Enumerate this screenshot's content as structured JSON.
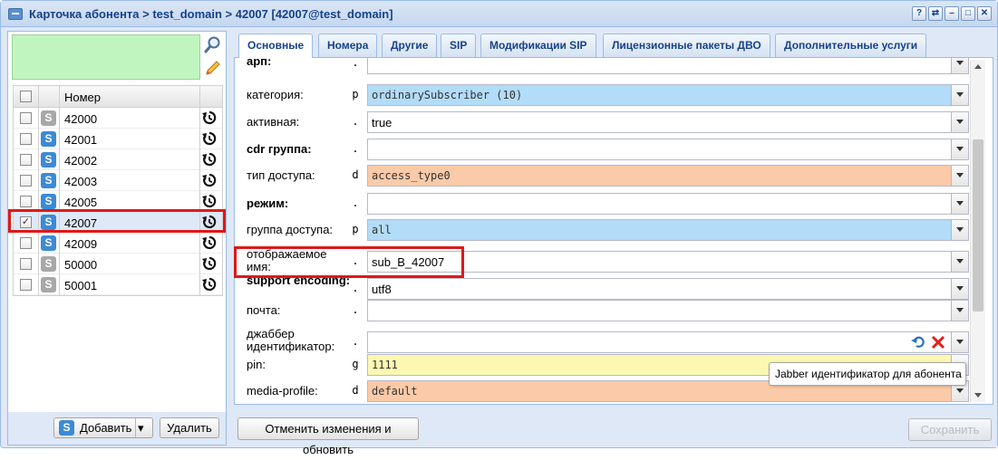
{
  "window": {
    "title": "Карточка абонента > test_domain > 42007 [42007@test_domain]",
    "tool_buttons": [
      "?",
      "⇄",
      "–",
      "□",
      "✕"
    ]
  },
  "left": {
    "column_header": "Номер",
    "rows": [
      {
        "number": "42000",
        "checked": false,
        "icon": "gray"
      },
      {
        "number": "42001",
        "checked": false,
        "icon": "blue"
      },
      {
        "number": "42002",
        "checked": false,
        "icon": "blue"
      },
      {
        "number": "42003",
        "checked": false,
        "icon": "blue"
      },
      {
        "number": "42005",
        "checked": false,
        "icon": "blue"
      },
      {
        "number": "42007",
        "checked": true,
        "icon": "blue"
      },
      {
        "number": "42009",
        "checked": false,
        "icon": "blue"
      },
      {
        "number": "50000",
        "checked": false,
        "icon": "gray"
      },
      {
        "number": "50001",
        "checked": false,
        "icon": "gray"
      }
    ],
    "add_label": "Добавить",
    "delete_label": "Удалить",
    "sip_glyph": "S",
    "check_glyph": "✓"
  },
  "tabs": [
    {
      "label": "Основные",
      "active": true
    },
    {
      "label": "Номера",
      "active": false
    },
    {
      "label": "Другие",
      "active": false
    },
    {
      "label": "SIP",
      "active": false
    },
    {
      "label": "Модификации SIP",
      "active": false
    },
    {
      "label": "Лицензионные пакеты ДВО",
      "active": false
    },
    {
      "label": "Дополнительные услуги",
      "active": false
    }
  ],
  "fields": [
    {
      "label": "арп:",
      "bold": true,
      "flag": ".",
      "value": "",
      "style": "plain"
    },
    {
      "label": "категория:",
      "bold": false,
      "flag": "p",
      "value": "ordinarySubscriber (10)",
      "style": "blue"
    },
    {
      "label": "активная:",
      "bold": false,
      "flag": ".",
      "value": "true",
      "style": "plain"
    },
    {
      "label": "cdr группа:",
      "bold": true,
      "flag": ".",
      "value": "",
      "style": "plain"
    },
    {
      "label": "тип доступа:",
      "bold": false,
      "flag": "d",
      "value": "access_type0",
      "style": "orange"
    },
    {
      "label": "режим:",
      "bold": true,
      "flag": ".",
      "value": "",
      "style": "plain"
    },
    {
      "label": "группа доступа:",
      "bold": false,
      "flag": "p",
      "value": "all",
      "style": "blue"
    },
    {
      "label": "отображаемое имя:",
      "bold": false,
      "flag": ".",
      "value": "sub_B_42007",
      "style": "plain"
    },
    {
      "label": "support encoding:",
      "bold": true,
      "flag": ".",
      "value": "utf8",
      "style": "plain"
    },
    {
      "label": "почта:",
      "bold": false,
      "flag": ".",
      "value": "",
      "style": "plain"
    },
    {
      "label": "джаббер идентификатор:",
      "bold": false,
      "flag": ".",
      "value": "",
      "style": "plain"
    },
    {
      "label": "pin:",
      "bold": false,
      "flag": "g",
      "value": "1111",
      "style": "yellow"
    },
    {
      "label": "media-profile:",
      "bold": false,
      "flag": "d",
      "value": "default",
      "style": "orange"
    }
  ],
  "tooltip": "Jabber идентификатор для абонента",
  "footer": {
    "revert_label": "Отменить изменения и обновить",
    "save_label": "Сохранить"
  },
  "colors": {
    "highlight": "#e01818",
    "blue_field": "#b2dcf8",
    "orange_field": "#fbcaa8",
    "yellow_field": "#fcf8b2",
    "green_box": "#c1f5bf"
  }
}
